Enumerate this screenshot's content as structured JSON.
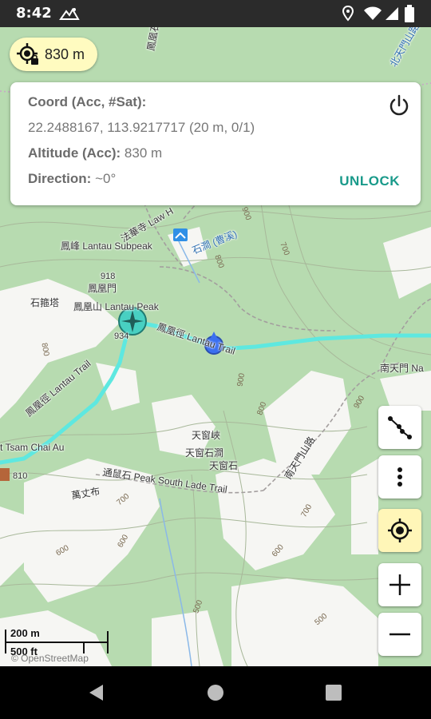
{
  "status_bar": {
    "time": "8:42",
    "left_icons": [
      "mountain-notification-icon"
    ],
    "right_icons": [
      "location-icon",
      "wifi-icon",
      "signal-icon",
      "battery-icon"
    ]
  },
  "accuracy_chip": {
    "text": "830 m",
    "icon": "gps-lock-icon"
  },
  "info_card": {
    "coord_label": "Coord (Acc, #Sat):",
    "coord_value": "22.2488167, 113.9217717 (20 m, 0/1)",
    "altitude_label": "Altitude (Acc):",
    "altitude_value": "830 m",
    "direction_label": "Direction:",
    "direction_value": "~0°",
    "unlock_label": "UNLOCK",
    "power_icon": "power-icon"
  },
  "map_labels": {
    "lantau_subpeak": "鳳峰 Lantau Subpeak",
    "fung_wong_mun": "鳳凰門",
    "lantau_peak": "鳳凰山 Lantau Peak",
    "shek_kwu_tap": "石箍塔",
    "elev_918": "918",
    "elev_934": "934",
    "lantau_trail_west": "鳳凰徑 Lantau Trail",
    "lantau_trail_east": "鳳凰徑 Lantau Trail",
    "tsam_chai_au": "t Tsam Chai Au",
    "elev_810": "810",
    "tin_kau_hap": "天窗峽",
    "tin_kau_shek_kan": "天窗石澗",
    "tin_kau_shek": "天窗石",
    "peak_south": "通鼠石 Peak South Lade Trail",
    "nam_tin_mun": "南天門 Na",
    "nam_tin_mun_road": "南天門山路",
    "law_hut": "法華寺 Law H",
    "stream": "石澗 (曹溪)",
    "north_road": "北天門山路",
    "top_trail": "鳳凰石",
    "wan_tai": "萬丈布"
  },
  "contour_labels": [
    "900",
    "800",
    "700",
    "600",
    "500",
    "900",
    "800",
    "700",
    "600",
    "500",
    "800",
    "900",
    "700",
    "600"
  ],
  "controls": {
    "track_icon": "polyline-icon",
    "more_icon": "more-vertical-icon",
    "locate_icon": "my-location-icon",
    "zoom_in_icon": "plus-icon",
    "zoom_out_icon": "minus-icon"
  },
  "scale_bar": {
    "metric": "200 m",
    "imperial": "500 ft"
  },
  "attribution": "© OpenStreetMap",
  "nav_bar": {
    "back": "back-triangle-icon",
    "home": "home-circle-icon",
    "recents": "recents-square-icon"
  },
  "colors": {
    "map_green": "#b7dbb0",
    "trail_cyan": "#5ee8e0",
    "chip_yellow": "#fffbc0",
    "unlock_teal": "#199a8a",
    "location_blue": "#3a6ff0"
  }
}
